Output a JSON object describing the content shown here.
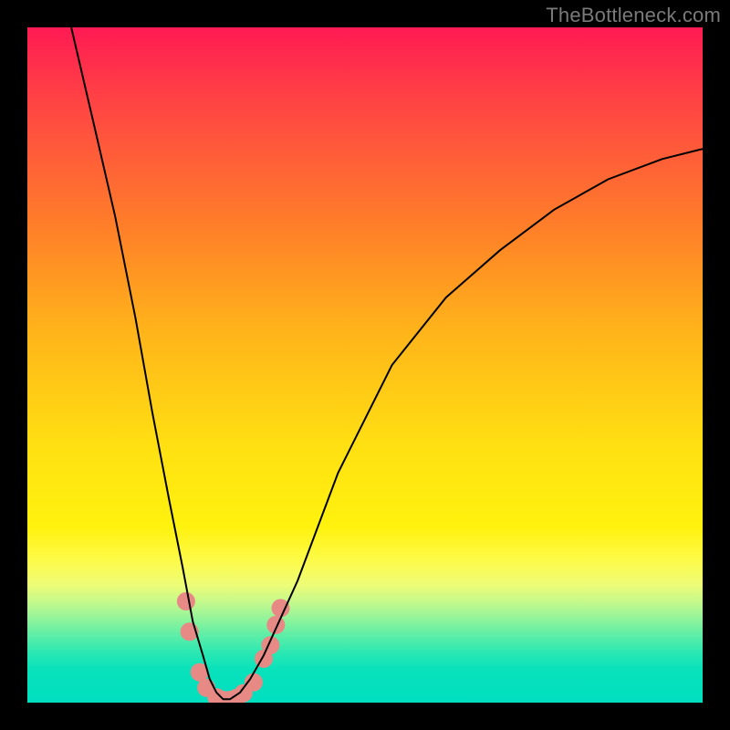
{
  "watermark": "TheBottleneck.com",
  "chart_data": {
    "type": "line",
    "title": "",
    "xlabel": "",
    "ylabel": "",
    "xlim": [
      0,
      100
    ],
    "ylim": [
      0,
      100
    ],
    "grid": false,
    "background_gradient": {
      "direction": "vertical",
      "stops": [
        {
          "pos": 0.0,
          "color": "#ff1a53"
        },
        {
          "pos": 0.08,
          "color": "#ff3948"
        },
        {
          "pos": 0.18,
          "color": "#ff5a3a"
        },
        {
          "pos": 0.3,
          "color": "#ff8028"
        },
        {
          "pos": 0.45,
          "color": "#ffb41a"
        },
        {
          "pos": 0.62,
          "color": "#ffe012"
        },
        {
          "pos": 0.74,
          "color": "#fff20e"
        },
        {
          "pos": 0.79,
          "color": "#fdfb4a"
        },
        {
          "pos": 0.825,
          "color": "#eefc76"
        },
        {
          "pos": 0.85,
          "color": "#c7f98c"
        },
        {
          "pos": 0.875,
          "color": "#93f49a"
        },
        {
          "pos": 0.9,
          "color": "#5eeea7"
        },
        {
          "pos": 0.925,
          "color": "#2de8b2"
        },
        {
          "pos": 0.95,
          "color": "#09e2bb"
        },
        {
          "pos": 1.0,
          "color": "#00dfc0"
        }
      ]
    },
    "series": [
      {
        "name": "bottleneck-curve",
        "color": "#000000",
        "stroke_width": 2,
        "x": [
          6.5,
          10,
          13,
          16,
          18.5,
          21,
          23,
          24.5,
          26,
          27,
          28,
          29,
          30,
          31.5,
          33,
          35,
          40,
          46,
          54,
          62,
          70,
          78,
          86,
          94,
          100
        ],
        "y": [
          100,
          85,
          72,
          57,
          43,
          30,
          20,
          12,
          7,
          3.5,
          1.5,
          0.5,
          0.5,
          1.5,
          3.5,
          7,
          18,
          34,
          50,
          60,
          67,
          73,
          77.5,
          80.5,
          82
        ]
      }
    ],
    "markers": [
      {
        "name": "highlight-dots",
        "color": "#e78a85",
        "radius": 10,
        "points": [
          {
            "x": 23.5,
            "y": 15
          },
          {
            "x": 24.0,
            "y": 10.5
          },
          {
            "x": 25.5,
            "y": 4.5
          },
          {
            "x": 26.5,
            "y": 2.2
          },
          {
            "x": 28.0,
            "y": 0.8
          },
          {
            "x": 29.0,
            "y": 0.4
          },
          {
            "x": 30.0,
            "y": 0.4
          },
          {
            "x": 31.0,
            "y": 0.7
          },
          {
            "x": 32.0,
            "y": 1.4
          },
          {
            "x": 33.5,
            "y": 3.0
          },
          {
            "x": 35.0,
            "y": 6.5
          },
          {
            "x": 36.0,
            "y": 8.5
          },
          {
            "x": 36.8,
            "y": 11.5
          },
          {
            "x": 37.5,
            "y": 14.0
          }
        ]
      }
    ]
  }
}
